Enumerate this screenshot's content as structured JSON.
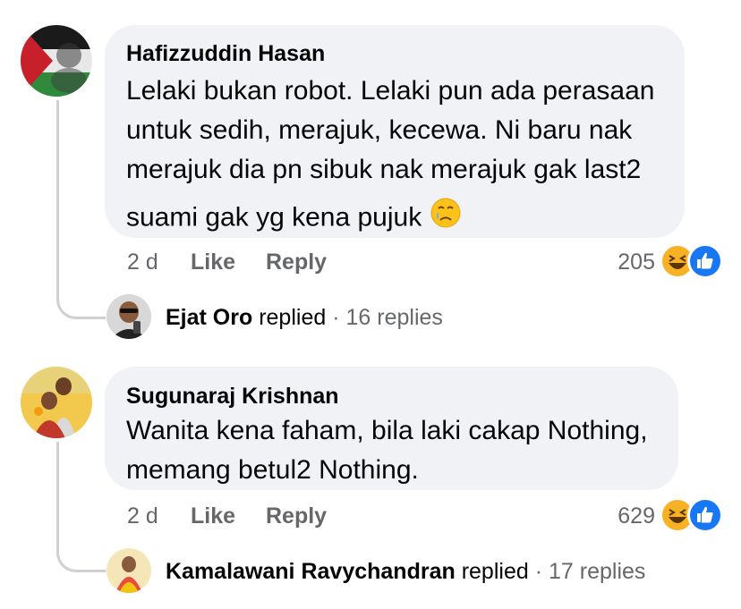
{
  "comments": [
    {
      "author": "Hafizzuddin Hasan",
      "lines": [
        "Lelaki bukan robot. Lelaki pun ada perasaan",
        "untuk sedih, merajuk, kecewa. Ni baru nak",
        "merajuk dia pn sibuk nak merajuk gak last2",
        "suami gak yg kena pujuk"
      ],
      "time": "2 d",
      "like_label": "Like",
      "reply_label": "Reply",
      "reaction_count": "205",
      "replies": {
        "name": "Ejat Oro",
        "verb": "replied",
        "sep": "·",
        "count": "16 replies"
      }
    },
    {
      "author": "Sugunaraj Krishnan",
      "lines": [
        "Wanita kena faham, bila laki cakap Nothing,",
        "memang betul2 Nothing."
      ],
      "time": "2 d",
      "like_label": "Like",
      "reply_label": "Reply",
      "reaction_count": "629",
      "replies": {
        "name": "Kamalawani Ravychandran",
        "verb": "replied",
        "sep": "·",
        "count": "17 replies"
      }
    }
  ],
  "icons": {
    "crying": "crying-face-icon",
    "haha": "haha-reaction-icon",
    "like": "like-reaction-icon"
  },
  "colors": {
    "bubble": "#f0f2f5",
    "meta": "#65676b",
    "like_blue": "#1877f2",
    "haha_yellow": "#f7b125"
  }
}
